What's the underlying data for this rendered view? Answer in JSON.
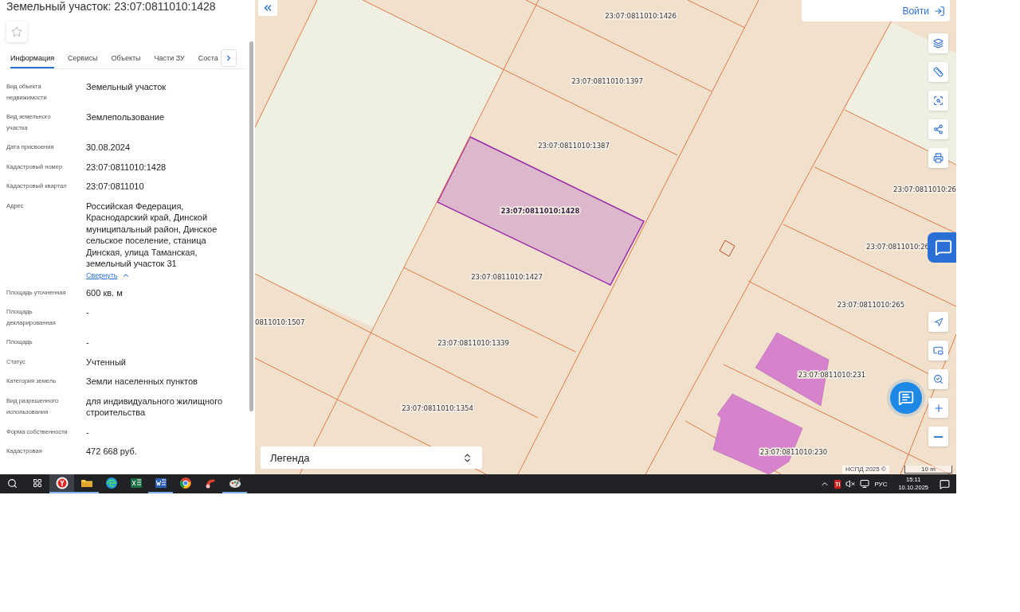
{
  "panel": {
    "title": "Земельный участок: 23:07:0811010:1428",
    "starred": false,
    "tabs": [
      {
        "label": "Информация",
        "selected": true
      },
      {
        "label": "Сервисы",
        "selected": false
      },
      {
        "label": "Объекты",
        "selected": false
      },
      {
        "label": "Части ЗУ",
        "selected": false
      },
      {
        "label": "Соста",
        "selected": false
      }
    ],
    "fields": [
      {
        "label": "Вид объекта недвижимости",
        "value": "Земельный участок"
      },
      {
        "label": "Вид земельного участка",
        "value": "Землепользование"
      },
      {
        "label": "Дата присвоения",
        "value": "30.08.2024"
      },
      {
        "label": "Кадастровый номер",
        "value": "23:07:0811010:1428"
      },
      {
        "label": "Кадастровый квартал",
        "value": "23:07:0811010"
      },
      {
        "label": "Адрес",
        "value": "Российская Федерация, Краснодарский край, Динской муниципальный район, Динское сельское поселение, станица Динская, улица Таманская, земельный участок 31",
        "toggle": "Свернуть"
      },
      {
        "label": "Площадь уточненная",
        "value": "600 кв. м"
      },
      {
        "label": "Площадь декларированная",
        "value": "-"
      },
      {
        "label": "Площадь",
        "value": "-"
      },
      {
        "label": "Статус",
        "value": "Учтенный"
      },
      {
        "label": "Категория земель",
        "value": "Земли населенных пунктов"
      },
      {
        "label": "Вид разрешенного использования",
        "value": "для индивидуального жилищного строительства"
      },
      {
        "label": "Форма собственности",
        "value": "-"
      },
      {
        "label": "Кадастровая",
        "value": "472 668 руб."
      }
    ]
  },
  "map": {
    "login": "Войти",
    "parcels": [
      {
        "label": "23:07:0811010:1426",
        "selected": false
      },
      {
        "label": "23:07:0811010:1397",
        "selected": false
      },
      {
        "label": "23:07:0811010:1387",
        "selected": false
      },
      {
        "label": "23:07:0811010:1428",
        "selected": true
      },
      {
        "label": "23:07:0811010:1427",
        "selected": false
      },
      {
        "label": "0811010:1507",
        "selected": false
      },
      {
        "label": "23:07:0811010:1339",
        "selected": false
      },
      {
        "label": "23:07:0811010:1354",
        "selected": false
      },
      {
        "label": "23:07:0811010:26",
        "selected": false
      },
      {
        "label": "23:07:0811010:26",
        "selected": false
      },
      {
        "label": "23:07:0811010:265",
        "selected": false
      },
      {
        "label": "23:07:0811010:231",
        "selected": false
      },
      {
        "label": "23:07:0811010:230",
        "selected": false
      }
    ],
    "legend": "Легенда",
    "attribution": "НСПД 2025 ©",
    "scale": "10 m"
  },
  "taskbar": {
    "apps": [
      {
        "kind": "yandex",
        "active": true,
        "running": true
      },
      {
        "kind": "explorer",
        "active": false,
        "running": true
      },
      {
        "kind": "edge",
        "active": false,
        "running": false
      },
      {
        "kind": "excel",
        "active": false,
        "running": false
      },
      {
        "kind": "word",
        "active": false,
        "running": true
      },
      {
        "kind": "chrome",
        "active": false,
        "running": false
      },
      {
        "kind": "tool",
        "active": false,
        "running": false
      },
      {
        "kind": "paint",
        "active": false,
        "running": true
      }
    ],
    "tray_badge": "Ti",
    "language": "РУС",
    "time": "15:11",
    "date": "10.10.2025"
  }
}
